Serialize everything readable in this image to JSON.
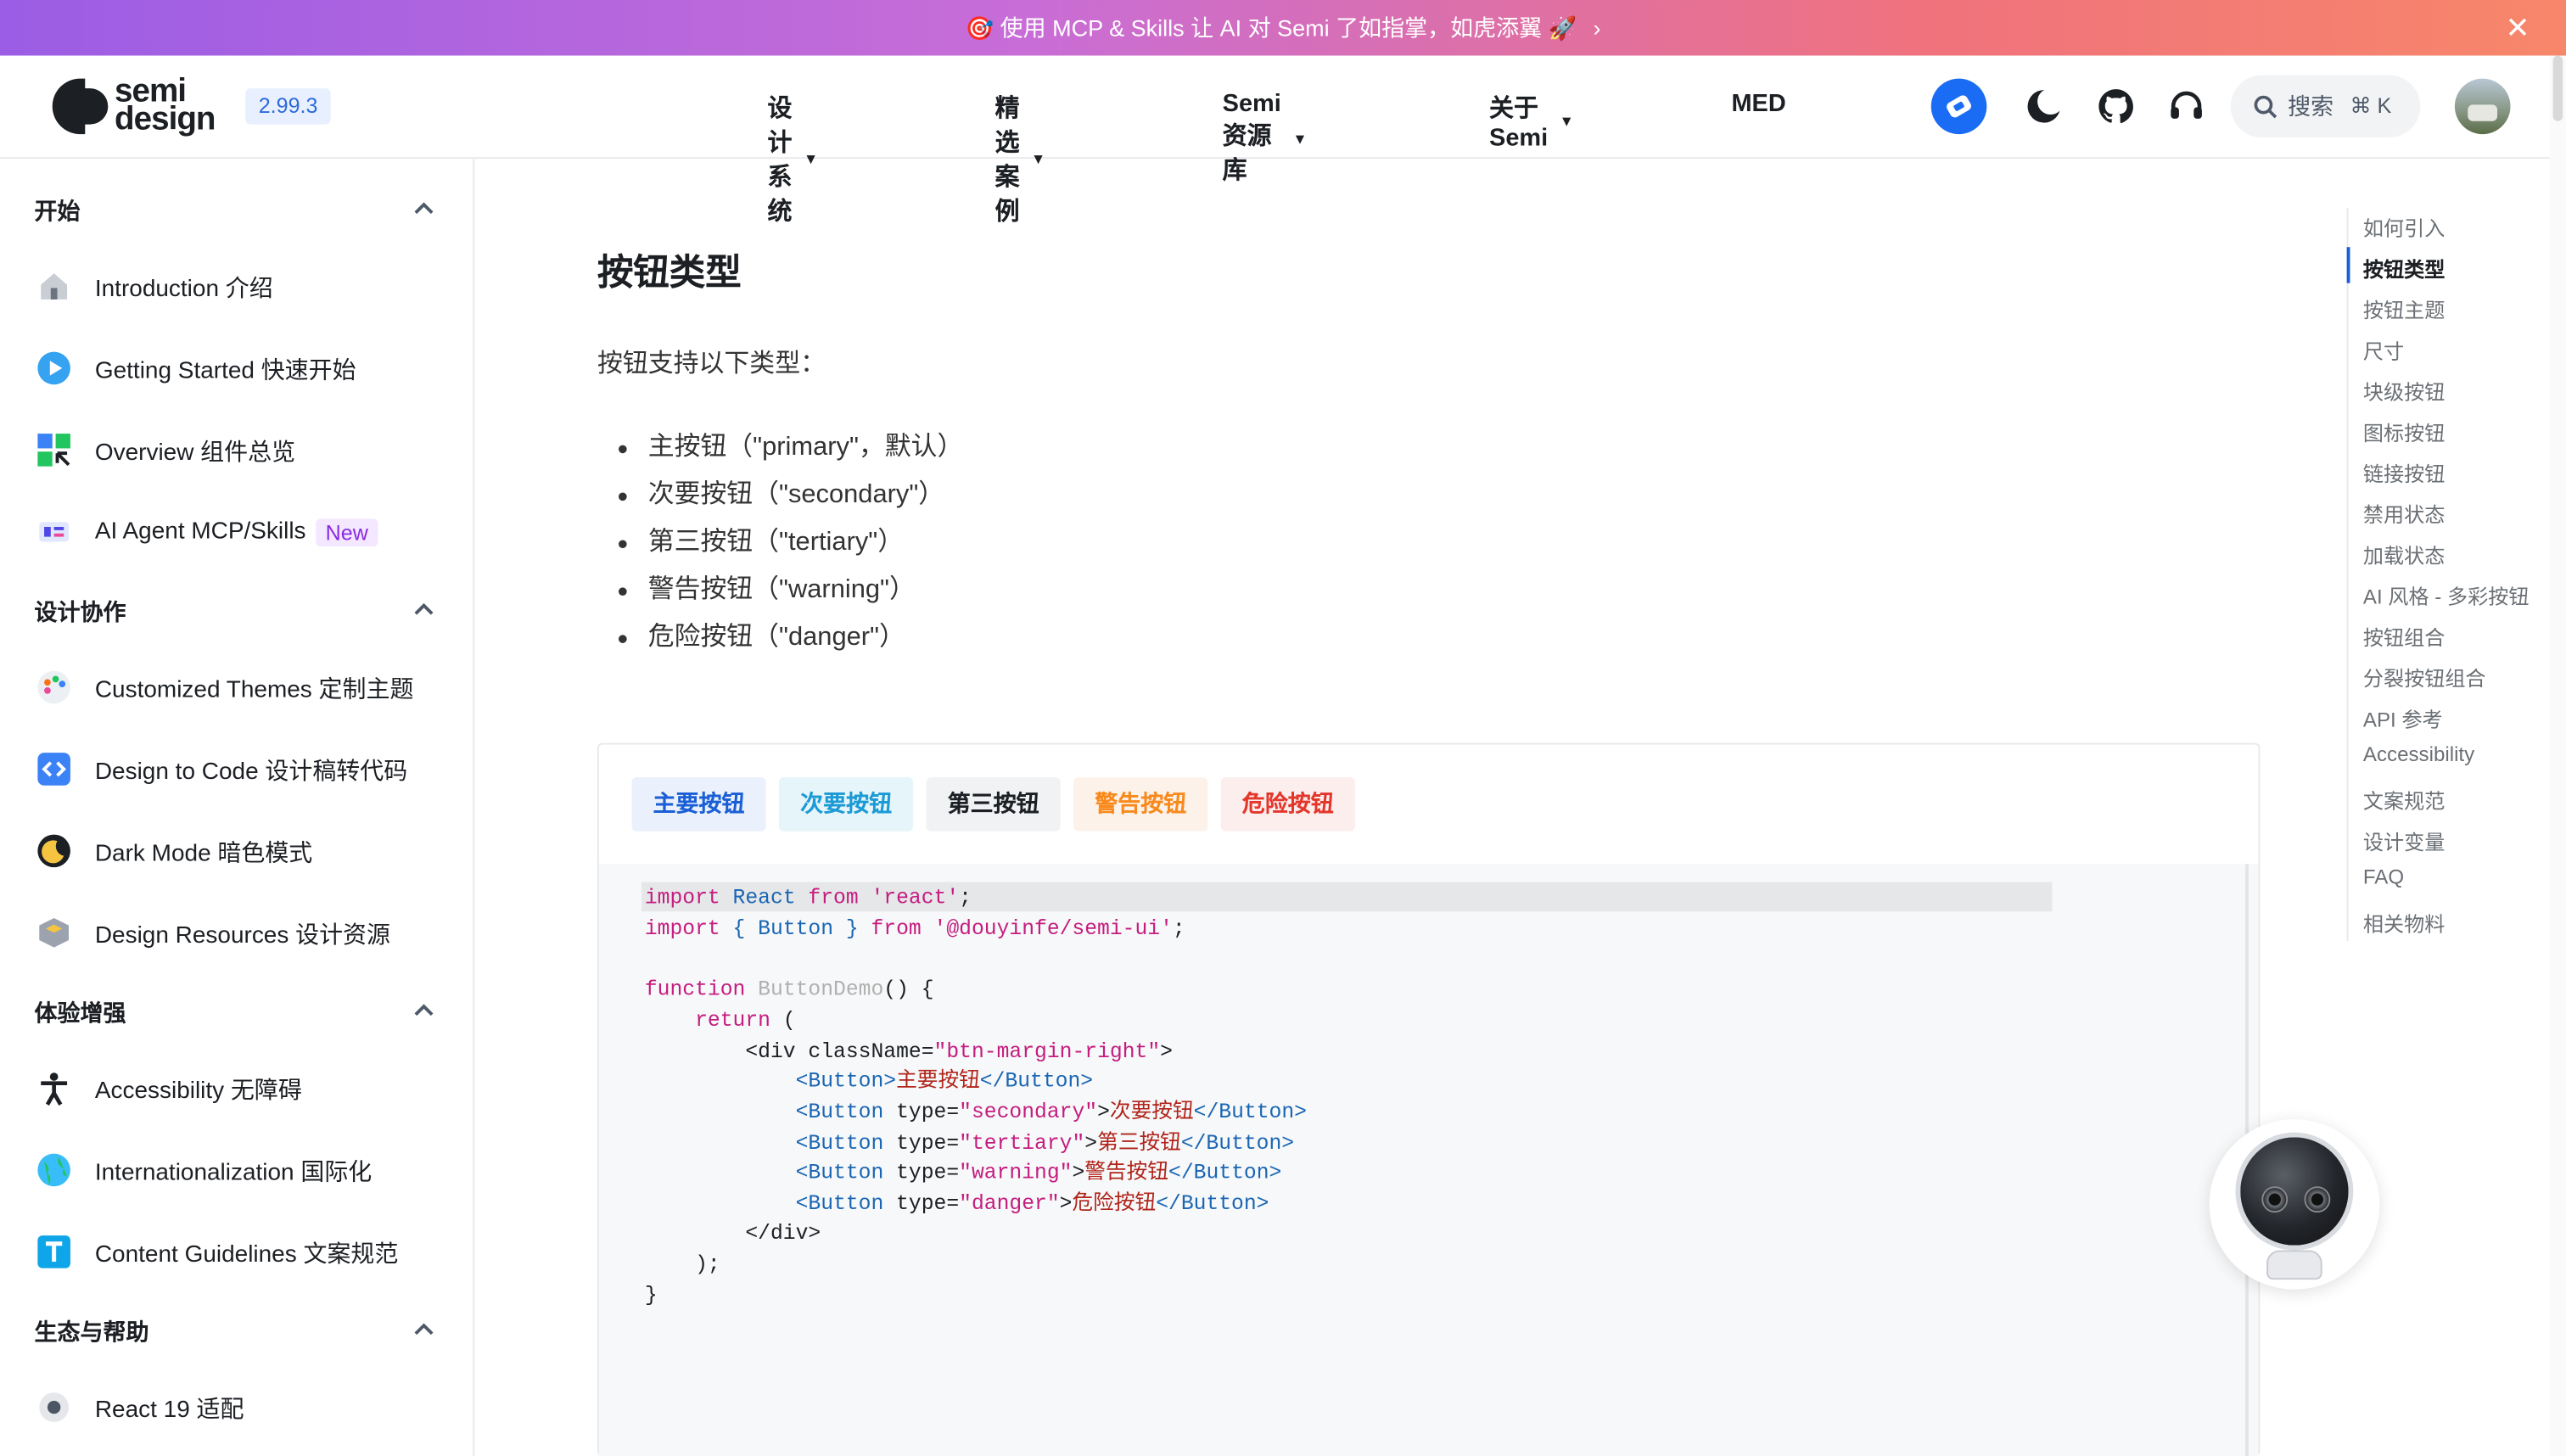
{
  "banner": {
    "text": "🎯 使用 MCP & Skills 让 AI 对 Semi 了如指掌，如虎添翼 🚀",
    "arrow": "›",
    "close": "✕"
  },
  "header": {
    "logo_line1": "semi",
    "logo_line2": "design",
    "version": "2.99.3",
    "nav": [
      {
        "label": "设计系统",
        "caret": "▼"
      },
      {
        "label": "精选案例",
        "caret": "▼"
      },
      {
        "label": "Semi 资源库",
        "caret": "▼"
      },
      {
        "label": "关于 Semi",
        "caret": "▼"
      },
      {
        "label": "MED",
        "caret": ""
      }
    ],
    "search_placeholder": "搜索",
    "search_shortcut": "⌘ K"
  },
  "sidebar": {
    "sections": [
      {
        "title": "开始",
        "items": [
          {
            "label": "Introduction 介绍",
            "icon": "home-icon"
          },
          {
            "label": "Getting Started 快速开始",
            "icon": "play-icon"
          },
          {
            "label": "Overview 组件总览",
            "icon": "grid-icon"
          },
          {
            "label": "AI Agent MCP/Skills",
            "icon": "ai-agent-icon",
            "badge": "New"
          }
        ]
      },
      {
        "title": "设计协作",
        "items": [
          {
            "label": "Customized Themes 定制主题",
            "icon": "palette-icon"
          },
          {
            "label": "Design to Code 设计稿转代码",
            "icon": "code-icon"
          },
          {
            "label": "Dark Mode 暗色模式",
            "icon": "moon-icon"
          },
          {
            "label": "Design Resources 设计资源",
            "icon": "box-icon"
          }
        ]
      },
      {
        "title": "体验增强",
        "items": [
          {
            "label": "Accessibility 无障碍",
            "icon": "accessibility-icon"
          },
          {
            "label": "Internationalization 国际化",
            "icon": "globe-icon"
          },
          {
            "label": "Content Guidelines 文案规范",
            "icon": "text-icon"
          }
        ]
      },
      {
        "title": "生态与帮助",
        "items": [
          {
            "label": "React 19 适配",
            "icon": "react-icon"
          }
        ]
      }
    ]
  },
  "content": {
    "heading": "按钮类型",
    "intro": "按钮支持以下类型：",
    "types": [
      "主按钮（\"primary\"，默认）",
      "次要按钮（\"secondary\"）",
      "第三按钮（\"tertiary\"）",
      "警告按钮（\"warning\"）",
      "危险按钮（\"danger\"）"
    ],
    "buttons": {
      "primary": "主要按钮",
      "secondary": "次要按钮",
      "tertiary": "第三按钮",
      "warning": "警告按钮",
      "danger": "危险按钮"
    }
  },
  "code": {
    "l1_kw1": "import",
    "l1_id": " React ",
    "l1_kw2": "from",
    "l1_str": " 'react'",
    "l1_end": ";",
    "l2_kw1": "import",
    "l2_mid": " { Button } ",
    "l2_kw2": "from",
    "l2_str": " '@douyinfe/semi-ui'",
    "l2_end": ";",
    "l4_kw": "function",
    "l4_fn": " ButtonDemo",
    "l4_end": "() {",
    "l5_kw": "return",
    "l5_end": " (",
    "l6_a": "<div className=",
    "l6_str": "\"btn-margin-right\"",
    "l6_b": ">",
    "l7_tag": "<Button>",
    "l7_cn": "主要按钮",
    "l7_close": "</Button>",
    "l8_tag": "<Button",
    "l8_attr": " type=",
    "l8_str": "\"secondary\"",
    "l8_gt": ">",
    "l8_cn": "次要按钮",
    "l8_close": "</Button>",
    "l9_tag": "<Button",
    "l9_attr": " type=",
    "l9_str": "\"tertiary\"",
    "l9_gt": ">",
    "l9_cn": "第三按钮",
    "l9_close": "</Button>",
    "l10_tag": "<Button",
    "l10_attr": " type=",
    "l10_str": "\"warning\"",
    "l10_gt": ">",
    "l10_cn": "警告按钮",
    "l10_close": "</Button>",
    "l11_tag": "<Button",
    "l11_attr": " type=",
    "l11_str": "\"danger\"",
    "l11_gt": ">",
    "l11_cn": "危险按钮",
    "l11_close": "</Button>",
    "l12": "</div>",
    "l13": ");",
    "l14": "}"
  },
  "toc": {
    "items": [
      "如何引入",
      "按钮类型",
      "按钮主题",
      "尺寸",
      "块级按钮",
      "图标按钮",
      "链接按钮",
      "禁用状态",
      "加载状态",
      "AI 风格 - 多彩按钮",
      "按钮组合",
      "分裂按钮组合",
      "API 参考",
      "Accessibility",
      "文案规范",
      "设计变量",
      "FAQ",
      "相关物料"
    ],
    "active": "按钮类型"
  },
  "colors": {
    "primary": "#1a5fd6",
    "banner_start": "#9b5de5",
    "banner_end": "#f7876a"
  }
}
